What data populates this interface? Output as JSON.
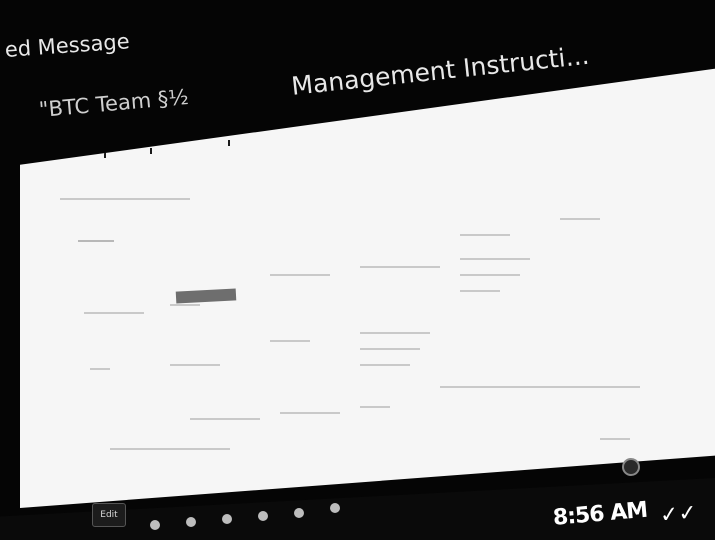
{
  "chat": {
    "forwarded_label": "ed Message",
    "sender": "\"BTC Team §½",
    "message_title": "Management Instructi..."
  },
  "status": {
    "time": "8:56 AM",
    "read_receipt": "✓✓"
  },
  "taskbar": {
    "left_button_label": "Edit"
  }
}
